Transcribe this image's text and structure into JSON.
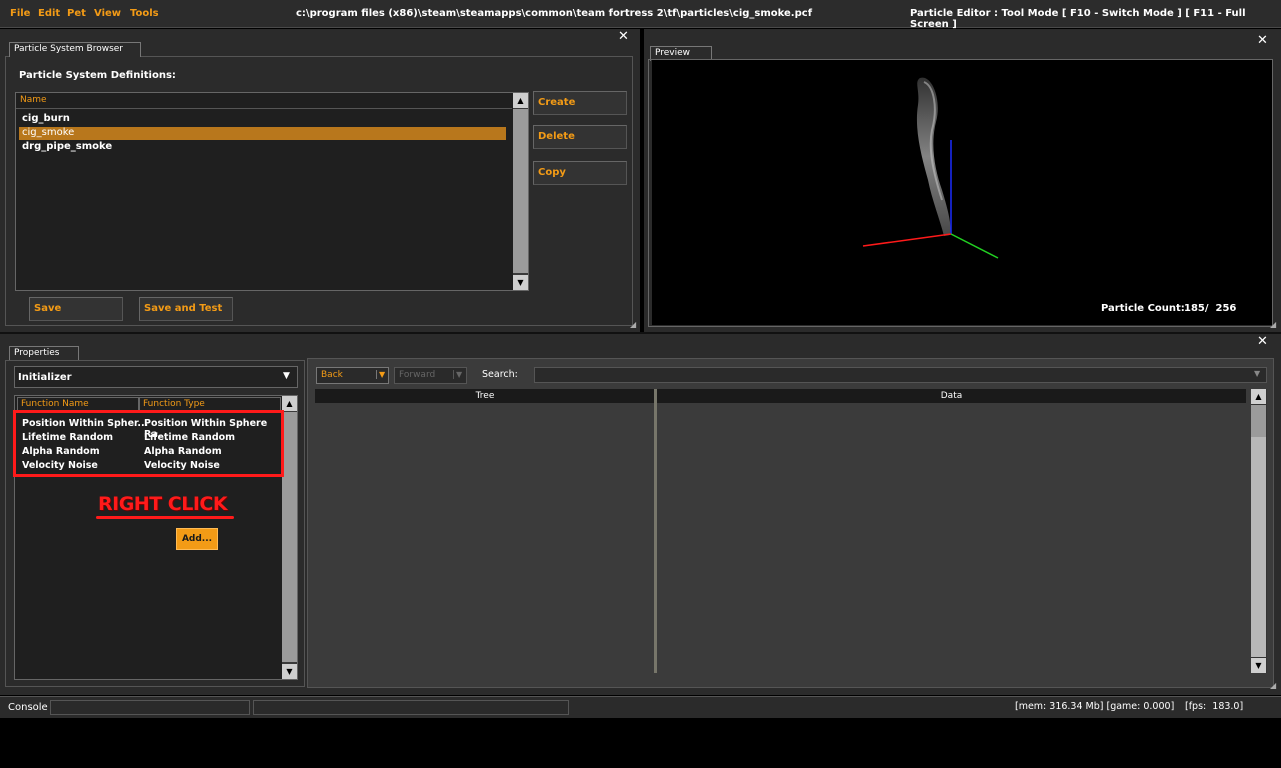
{
  "menu": {
    "items": [
      "File",
      "Edit",
      "Pet",
      "View",
      "Tools"
    ],
    "file_path": "c:\\program files (x86)\\steam\\steamapps\\common\\team fortress 2\\tf\\particles\\cig_smoke.pcf",
    "mode_text": "Particle Editor  : Tool Mode [ F10 - Switch Mode ] [ F11 - Full Screen ]"
  },
  "browser": {
    "tab": "Particle System Browser",
    "definitions_label": "Particle System Definitions:",
    "column_name": "Name",
    "items": [
      "cig_burn",
      "cig_smoke",
      "drg_pipe_smoke"
    ],
    "selected_index": 1,
    "buttons": {
      "create": "Create",
      "delete": "Delete",
      "copy": "Copy",
      "save": "Save",
      "save_and_test": "Save and Test"
    }
  },
  "preview": {
    "tab": "Preview",
    "particle_count_label": "Particle Count:",
    "particle_count_value": "185/  256"
  },
  "properties": {
    "tab": "Properties",
    "category": "Initializer",
    "column_function_name": "Function Name",
    "column_function_type": "Function Type",
    "functions": [
      {
        "name": "Position Within Spher...",
        "type": "Position Within Sphere Ra."
      },
      {
        "name": "Lifetime Random",
        "type": "Lifetime Random"
      },
      {
        "name": "Alpha Random",
        "type": "Alpha Random"
      },
      {
        "name": "Velocity Noise",
        "type": "Velocity Noise"
      }
    ],
    "annotation": "RIGHT CLICK",
    "add_button": "Add...",
    "back": "Back",
    "forward": "Forward",
    "search_label": "Search:",
    "tree_header": "Tree",
    "data_header": "Data"
  },
  "status": {
    "console": "Console",
    "mem": "[mem: 316.34 Mb] [game: 0.000]",
    "fps": "[fps:  183.0]"
  },
  "colors": {
    "accent": "#f39b16",
    "selection": "#b8771c",
    "annotation_red": "#ff1a1a"
  }
}
